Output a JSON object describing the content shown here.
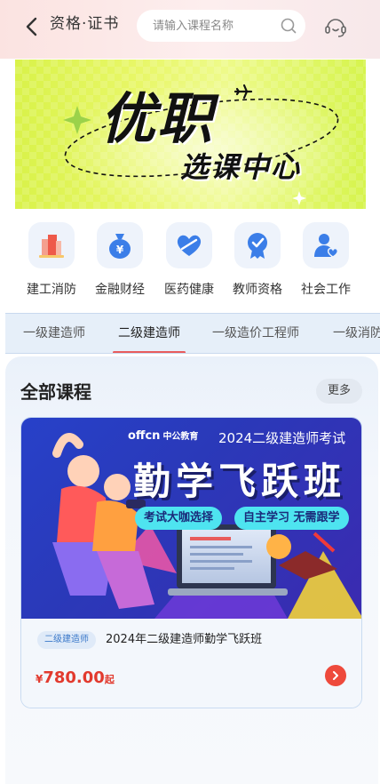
{
  "header": {
    "title": "资格·证书",
    "search_placeholder": "请输入课程名称"
  },
  "banner": {
    "line1": "优职",
    "line2": "选课中心"
  },
  "categories": [
    {
      "label": "建工消防",
      "icon": "building-icon"
    },
    {
      "label": "金融财经",
      "icon": "money-bag-icon"
    },
    {
      "label": "医药健康",
      "icon": "heart-icon"
    },
    {
      "label": "教师资格",
      "icon": "medal-icon"
    },
    {
      "label": "社会工作",
      "icon": "person-heart-icon"
    }
  ],
  "tabs": [
    {
      "label": "一级建造师",
      "active": false
    },
    {
      "label": "二级建造师",
      "active": true
    },
    {
      "label": "一级造价工程师",
      "active": false
    },
    {
      "label": "一级消防",
      "active": false
    }
  ],
  "section": {
    "title": "全部课程",
    "more_label": "更多"
  },
  "course": {
    "image": {
      "brand": "offcn",
      "brand_cn": "中公教育",
      "exam": "2024二级建造师考试",
      "headline": "勤学飞跃班",
      "pill1": "考试大咖选择",
      "pill2": "自主学习 无需跟学"
    },
    "tag": "二级建造师",
    "name": "2024年二级建造师勤学飞跃班",
    "price_symbol": "¥",
    "price": "780.00",
    "price_suffix": "起"
  },
  "colors": {
    "accent_red": "#e23a2e",
    "tab_underline": "#e85c5c",
    "icon_blue": "#3b7ee8",
    "banner_green": "#dcf352"
  }
}
